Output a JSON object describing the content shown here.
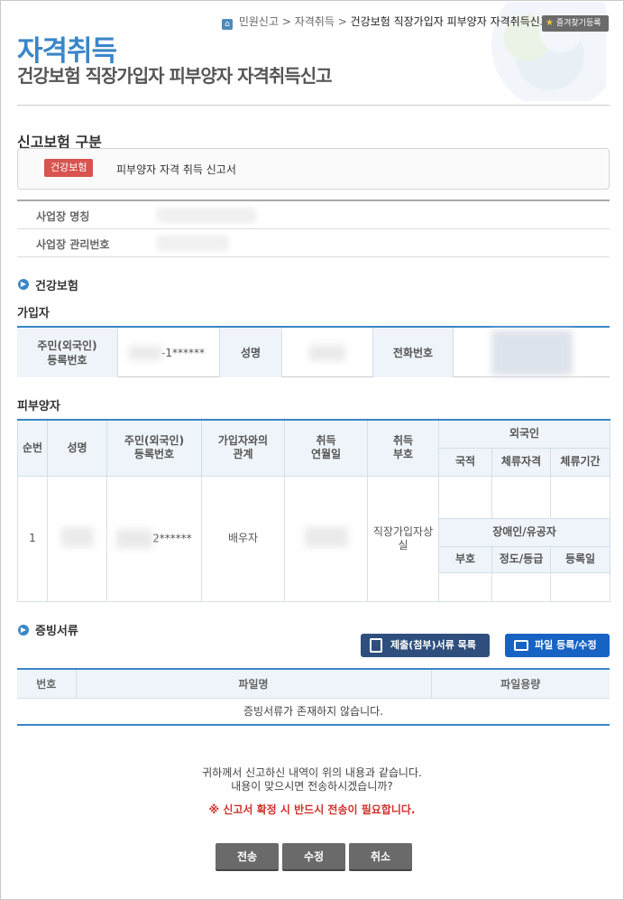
{
  "header": {
    "breadcrumb": [
      "민원신고",
      "자격취득",
      "건강보험 직장가입자 피부양자 자격취득신고"
    ],
    "breadcrumb_sep": ">",
    "favorite_label": "즐겨찾기등록",
    "title": "자격취득",
    "subtitle": "건강보험 직장가입자 피부양자 자격취득신고"
  },
  "insurance_type": {
    "section_title": "신고보험 구분",
    "badge": "건강보험",
    "text": "피부양자 자격 취득 신고서"
  },
  "workplace": {
    "name_label": "사업장 명칭",
    "number_label": "사업장 관리번호"
  },
  "health_section": {
    "title": "건강보험"
  },
  "subscriber": {
    "title": "가입자",
    "id_label_1": "주민(외국인)",
    "id_label_2": "등록번호",
    "id_value": "-1******",
    "name_label": "성명",
    "phone_label": "전화번호"
  },
  "dependent": {
    "title": "피부양자",
    "headers": {
      "seq": "순번",
      "name": "성명",
      "id_1": "주민(외국인)",
      "id_2": "등록번호",
      "rel_1": "가입자와의",
      "rel_2": "관계",
      "date_1": "취득",
      "date_2": "연월일",
      "code_1": "취득",
      "code_2": "부호",
      "foreigner": "외국인",
      "nationality": "국적",
      "stay_status": "체류자격",
      "stay_period": "체류기간",
      "disabled": "장애인/유공자",
      "dis_code": "부호",
      "dis_grade": "정도/등급",
      "dis_date": "등록일"
    },
    "row": {
      "seq": "1",
      "id_value": "2******",
      "relation": "배우자",
      "code_1": "직장가입자상",
      "code_2": "실"
    }
  },
  "evidence": {
    "title": "증빙서류",
    "list_button": "제출(첨부)서류 목록",
    "file_button": "파일 등록/수정",
    "col_no": "번호",
    "col_name": "파일명",
    "col_size": "파일용량",
    "empty_text": "증빙서류가 존재하지 않습니다."
  },
  "notice": {
    "line1": "귀하께서 신고하신 내역이 위의 내용과 같습니다.",
    "line2": "내용이 맞으시면 전송하시겠습니까?",
    "warning": "※ 신고서 확정 시 반드시 전송이 필요합니다."
  },
  "actions": {
    "send": "전송",
    "edit": "수정",
    "cancel": "취소"
  },
  "colors": {
    "accent": "#3a86c8",
    "badge": "#d9534f",
    "warning": "#d0302a"
  }
}
